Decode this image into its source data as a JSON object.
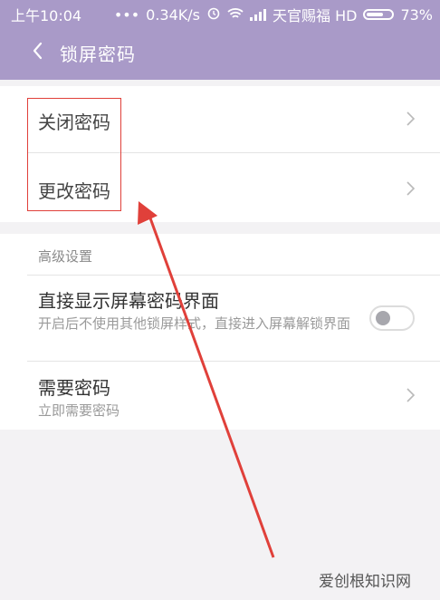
{
  "status_bar": {
    "time": "上午10:04",
    "speed": "0.34K/s",
    "carrier": "天官赐福 HD",
    "battery": "73%",
    "battery_level": 0.73
  },
  "header": {
    "title": "锁屏密码"
  },
  "password_options": [
    {
      "label": "关闭密码"
    },
    {
      "label": "更改密码"
    }
  ],
  "advanced": {
    "section_title": "高级设置",
    "items": [
      {
        "title": "直接显示屏幕密码界面",
        "description": "开启后不使用其他锁屏样式，直接进入屏幕解锁界面",
        "toggle_on": false
      },
      {
        "title": "需要密码",
        "description": "立即需要密码"
      }
    ]
  },
  "colors": {
    "accent": "#a99ac8",
    "annotation": "#e0403a"
  },
  "watermark": "爱创根知识网"
}
